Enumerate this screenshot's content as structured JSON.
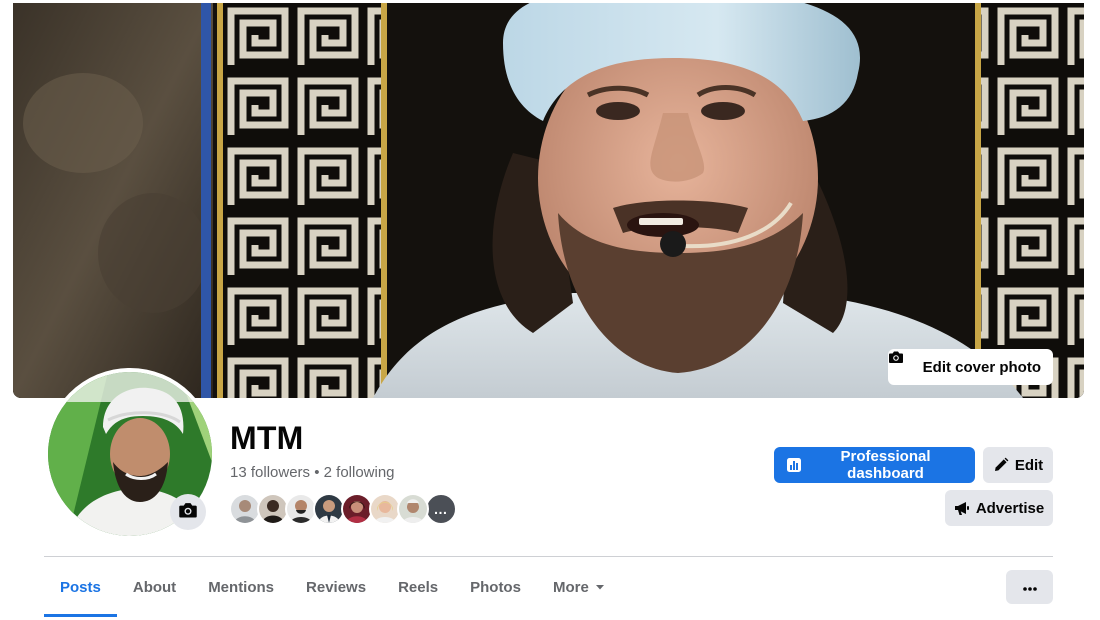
{
  "cover": {
    "edit_label": "Edit cover photo",
    "icon": "camera-icon"
  },
  "profile": {
    "name": "MTM",
    "followers_text": "13 followers",
    "separator": " • ",
    "following_text": "2 following",
    "avatar_camera_icon": "camera-icon",
    "friend_faces_more": "…"
  },
  "actions": {
    "professional_dashboard": "Professional dashboard",
    "edit": "Edit",
    "advertise": "Advertise"
  },
  "tabs": [
    {
      "label": "Posts",
      "active": true
    },
    {
      "label": "About",
      "active": false
    },
    {
      "label": "Mentions",
      "active": false
    },
    {
      "label": "Reviews",
      "active": false
    },
    {
      "label": "Reels",
      "active": false
    },
    {
      "label": "Photos",
      "active": false
    },
    {
      "label": "More",
      "active": false
    }
  ],
  "colors": {
    "accent": "#1b74e4",
    "secondary_button": "#e4e6eb",
    "muted_text": "#65676b",
    "divider": "#ced0d4"
  }
}
